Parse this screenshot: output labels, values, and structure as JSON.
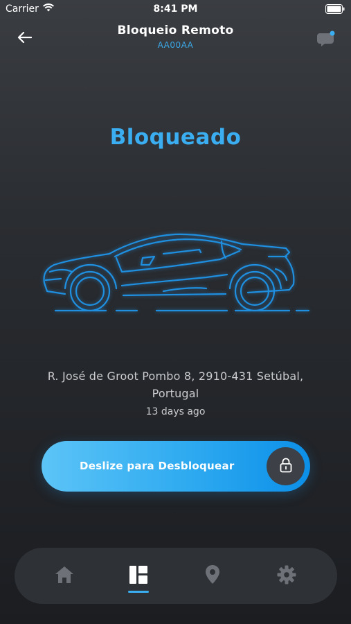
{
  "status_bar": {
    "carrier": "Carrier",
    "time": "8:41 PM"
  },
  "header": {
    "title": "Bloqueio Remoto",
    "plate": "AA00AA",
    "back_icon": "arrow-left-icon",
    "chat_icon": "chat-bubble-icon",
    "chat_has_notification": true
  },
  "lock": {
    "status": "Bloqueado",
    "status_color": "#3aaef0"
  },
  "location": {
    "address": "R. José de Groot Pombo 8, 2910-431 Setúbal, Portugal",
    "time_ago": "13 days ago"
  },
  "slider": {
    "label": "Deslize para Desbloquear",
    "knob_icon": "lock-icon"
  },
  "nav": {
    "items": [
      {
        "icon": "home-icon",
        "active": false
      },
      {
        "icon": "dashboard-icon",
        "active": true
      },
      {
        "icon": "location-pin-icon",
        "active": false
      },
      {
        "icon": "gear-icon",
        "active": false
      }
    ]
  },
  "colors": {
    "accent": "#3aaef0",
    "background": "#2a2d31",
    "nav_bg": "#2e3136"
  }
}
